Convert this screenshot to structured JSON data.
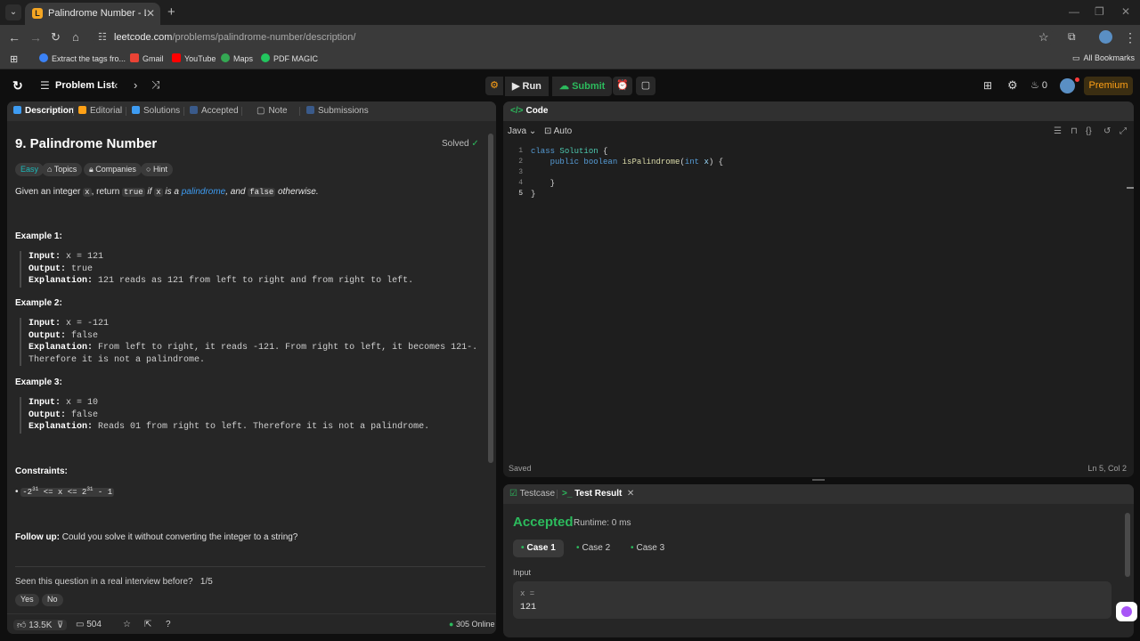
{
  "browser": {
    "tab_title": "Palindrome Number - LeetCode",
    "url_host": "leetcode.com",
    "url_path": "/problems/palindrome-number/description/",
    "bookmarks": [
      "Extract the tags fro...",
      "Gmail",
      "YouTube",
      "Maps",
      "PDF MAGIC"
    ],
    "all_bookmarks": "All Bookmarks"
  },
  "header": {
    "problem_list": "Problem List",
    "run": "Run",
    "submit": "Submit",
    "streak": "0",
    "premium": "Premium"
  },
  "left_tabs": [
    "Description",
    "Editorial",
    "Solutions",
    "Accepted",
    "Note",
    "Submissions"
  ],
  "problem": {
    "title": "9. Palindrome Number",
    "status": "Solved",
    "difficulty": "Easy",
    "chips": [
      "Topics",
      "Companies",
      "Hint"
    ],
    "desc_parts": [
      "Given an integer ",
      "x",
      ", return ",
      "true",
      " if ",
      "x",
      " is a ",
      "palindrome",
      ", and ",
      "false",
      " otherwise."
    ],
    "examples": [
      {
        "head": "Example 1:",
        "input": "x = 121",
        "output": "true",
        "explanation": [
          "121 reads as 121 from left to right and from right to left."
        ]
      },
      {
        "head": "Example 2:",
        "input": "x = -121",
        "output": "false",
        "explanation": [
          "From left to right, it reads -121. From right to left, it becomes 121-.",
          "Therefore it is not a palindrome."
        ]
      },
      {
        "head": "Example 3:",
        "input": "x = 10",
        "output": "false",
        "explanation": [
          "Reads 01 from right to left. Therefore it is not a palindrome."
        ]
      }
    ],
    "labels": {
      "input": "Input:",
      "output": "Output:",
      "explanation": "Explanation:"
    },
    "constraints_head": "Constraints:",
    "constraint_parts": [
      "-2",
      "31",
      " <= x <= 2",
      "31",
      " - 1"
    ],
    "followup_label": "Follow up:",
    "followup_text": " Could you solve it without converting the integer to a string?",
    "seen_question": "Seen this question in a real interview before?",
    "seen_count": "1/5",
    "yes": "Yes",
    "no": "No"
  },
  "left_footer": {
    "likes": "13.5K",
    "comments": "504",
    "online": "305 Online"
  },
  "code": {
    "title": "Code",
    "language": "Java",
    "mode": "Auto",
    "lines": [
      "1",
      "2",
      "3",
      "4",
      "5"
    ],
    "saved": "Saved",
    "position": "Ln 5, Col 2"
  },
  "result": {
    "tabs": [
      "Testcase",
      "Test Result"
    ],
    "status": "Accepted",
    "runtime": "Runtime: 0 ms",
    "cases": [
      "Case 1",
      "Case 2",
      "Case 3"
    ],
    "input_label": "Input",
    "var": "x =",
    "value": "121"
  },
  "colors": {
    "accepted": "#2cbb5d",
    "easy": "#1cb8b8",
    "premium": "#ffa116",
    "link": "#3e9cf2"
  }
}
